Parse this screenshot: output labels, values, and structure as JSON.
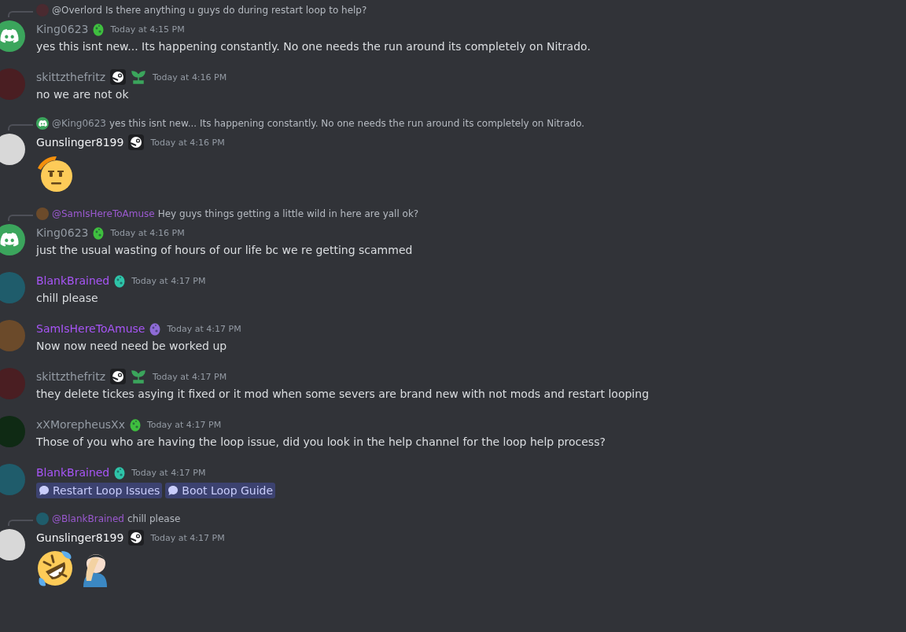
{
  "messages": [
    {
      "reply": {
        "avatar": {
          "kind": "photo",
          "color": "#4a2a30"
        },
        "mention": "@Overlord",
        "color": "#b5bac1",
        "text": "Is there anything u guys do during restart loop to help?"
      },
      "avatar": {
        "kind": "discord",
        "color": "#3ba55c"
      },
      "author": "King0623",
      "color": "#949ba4",
      "badges": [
        {
          "kind": "egg",
          "color": "#3fbf3f"
        }
      ],
      "time": "Today at 4:15 PM",
      "content": {
        "kind": "text",
        "text": "yes this isnt new... Its happening constantly. No one needs the run around its completely on Nitrado."
      }
    },
    {
      "avatar": {
        "kind": "photo",
        "color": "#4a1e22"
      },
      "author": "skittzthefritz",
      "color": "#949ba4",
      "badges": [
        {
          "kind": "steam",
          "color": "#1e1f22"
        },
        {
          "kind": "sprout",
          "color": "#3ba55c"
        }
      ],
      "time": "Today at 4:16 PM",
      "content": {
        "kind": "text",
        "text": "no we are not ok"
      }
    },
    {
      "reply": {
        "avatar": {
          "kind": "discord",
          "color": "#3ba55c"
        },
        "mention": "@King0623",
        "color": "#949ba4",
        "text": "yes this isnt new... Its happening constantly. No one needs the run around its completely on Nitrado."
      },
      "avatar": {
        "kind": "photo",
        "color": "#d8d8d8"
      },
      "author": "Gunslinger8199",
      "color": "#f2f3f5",
      "badges": [
        {
          "kind": "steam",
          "color": "#1e1f22"
        }
      ],
      "time": "Today at 4:16 PM",
      "content": {
        "kind": "emoji",
        "items": [
          {
            "kind": "salute"
          }
        ]
      }
    },
    {
      "reply": {
        "avatar": {
          "kind": "photo",
          "color": "#6b4a2a"
        },
        "mention": "@SamIsHereToAmuse",
        "color": "#9b59d0",
        "text": "Hey guys things getting a little wild in here are yall ok?"
      },
      "avatar": {
        "kind": "discord",
        "color": "#3ba55c"
      },
      "author": "King0623",
      "color": "#949ba4",
      "badges": [
        {
          "kind": "egg",
          "color": "#3fbf3f"
        }
      ],
      "time": "Today at 4:16 PM",
      "content": {
        "kind": "text",
        "text": "just the usual wasting of hours of our life bc we re getting scammed"
      }
    },
    {
      "avatar": {
        "kind": "photo",
        "color": "#1f5c6b"
      },
      "author": "BlankBrained",
      "color": "#a855f7",
      "badges": [
        {
          "kind": "egg",
          "color": "#2ec4a8"
        }
      ],
      "time": "Today at 4:17 PM",
      "content": {
        "kind": "text",
        "text": "chill please"
      }
    },
    {
      "avatar": {
        "kind": "photo",
        "color": "#6b4a2a"
      },
      "author": "SamIsHereToAmuse",
      "color": "#a855f7",
      "badges": [
        {
          "kind": "egg",
          "color": "#8e6bd6"
        }
      ],
      "time": "Today at 4:17 PM",
      "content": {
        "kind": "text",
        "text": "Now now need need be worked up"
      }
    },
    {
      "avatar": {
        "kind": "photo",
        "color": "#4a1e22"
      },
      "author": "skittzthefritz",
      "color": "#949ba4",
      "badges": [
        {
          "kind": "steam",
          "color": "#1e1f22"
        },
        {
          "kind": "sprout",
          "color": "#3ba55c"
        }
      ],
      "time": "Today at 4:17 PM",
      "content": {
        "kind": "text",
        "text": "they delete tickes asying it fixed or it mod when some severs are brand new with not mods and restart looping"
      }
    },
    {
      "avatar": {
        "kind": "photo",
        "color": "#0f2a14"
      },
      "author": "xXMorepheusXx",
      "color": "#949ba4",
      "badges": [
        {
          "kind": "egg",
          "color": "#3fbf3f"
        }
      ],
      "time": "Today at 4:17 PM",
      "content": {
        "kind": "text",
        "text": "Those of you who are having the loop issue, did you look in the help channel for the loop help process?"
      }
    },
    {
      "avatar": {
        "kind": "photo",
        "color": "#1f5c6b"
      },
      "author": "BlankBrained",
      "color": "#a855f7",
      "badges": [
        {
          "kind": "egg",
          "color": "#2ec4a8"
        }
      ],
      "time": "Today at 4:17 PM",
      "content": {
        "kind": "channels",
        "items": [
          {
            "label": "Restart Loop Issues"
          },
          {
            "label": "Boot Loop Guide"
          }
        ]
      }
    },
    {
      "reply": {
        "avatar": {
          "kind": "photo",
          "color": "#1f5c6b"
        },
        "mention": "@BlankBrained",
        "color": "#9b59d0",
        "text": "chill please"
      },
      "avatar": {
        "kind": "photo",
        "color": "#d8d8d8"
      },
      "author": "Gunslinger8199",
      "color": "#f2f3f5",
      "badges": [
        {
          "kind": "steam",
          "color": "#1e1f22"
        }
      ],
      "time": "Today at 4:17 PM",
      "content": {
        "kind": "emoji",
        "items": [
          {
            "kind": "rofl"
          },
          {
            "kind": "facepalm"
          }
        ]
      }
    }
  ]
}
